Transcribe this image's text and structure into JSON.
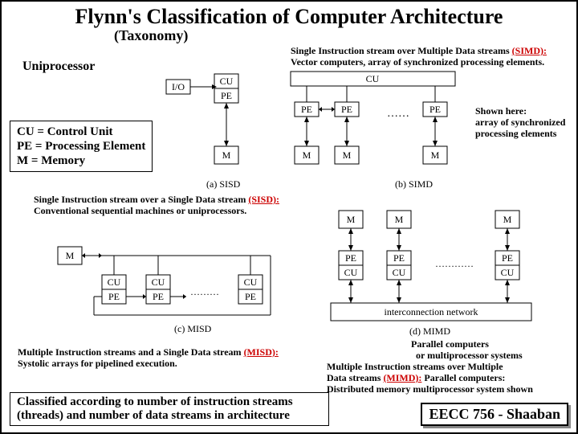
{
  "title": "Flynn's Classification of Computer Architecture",
  "subtitle": "(Taxonomy)",
  "uniprocessor": "Uniprocessor",
  "simd_caption_l1": "Single Instruction stream over Multiple Data streams ",
  "simd_caption_acr": "(SIMD):",
  "simd_caption_l2": "Vector computers, array of synchronized processing elements.",
  "shown_here_l1": "Shown here:",
  "shown_here_l2": "array of synchronized",
  "shown_here_l3": "processing elements",
  "legend_l1": "CU = Control Unit",
  "legend_l2": "PE = Processing Element",
  "legend_l3": "M = Memory",
  "sisd_label": "(a) SISD",
  "simd_label": "(b) SIMD",
  "misd_label": "(c) MISD",
  "mimd_label": "(d) MIMD",
  "sisd_caption_l1": "Single Instruction stream over a Single Data stream ",
  "sisd_caption_acr": "(SISD):",
  "sisd_caption_l2": "Conventional sequential machines or uniprocessors.",
  "misd_caption_l1": "Multiple Instruction streams and a Single Data stream ",
  "misd_caption_acr": "(MISD):",
  "misd_caption_l2": "Systolic arrays for pipelined execution.",
  "mimd_side_l1": "Parallel computers",
  "mimd_side_l2": "or multiprocessor systems",
  "mimd_caption_l1": "Multiple Instruction streams over Multiple",
  "mimd_caption_l2a": "Data streams ",
  "mimd_caption_acr": "(MIMD):",
  "mimd_caption_l2b": "  Parallel computers:",
  "mimd_caption_l3": "Distributed memory multiprocessor system shown",
  "footer_left": "Classified according to number of instruction streams (threads) and number of data streams in architecture",
  "footer_right": "EECC 756 - Shaaban",
  "labels": {
    "IO": "I/O",
    "CU": "CU",
    "PE": "PE",
    "M": "M",
    "interconnect": "interconnection network"
  }
}
